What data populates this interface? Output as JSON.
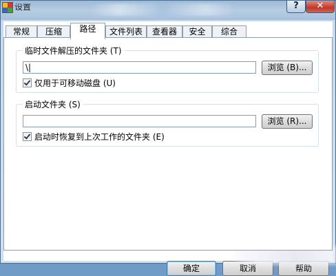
{
  "window": {
    "title": "设置",
    "help_label": "?",
    "close_label": "✕"
  },
  "tabs": [
    {
      "label": "常规"
    },
    {
      "label": "压缩"
    },
    {
      "label": "路径"
    },
    {
      "label": "文件列表"
    },
    {
      "label": "查看器"
    },
    {
      "label": "安全"
    },
    {
      "label": "综合"
    }
  ],
  "active_tab": "路径",
  "temp_group": {
    "title": "临时文件解压的文件夹 (T)",
    "path_value": "\\|",
    "browse_label": "浏览 (B)...",
    "checkbox_label": "仅用于可移动磁盘 (U)",
    "checkbox_checked": true
  },
  "startup_group": {
    "title": "启动文件夹 (S)",
    "path_value": "",
    "browse_label": "浏览 (R)...",
    "checkbox_label": "启动时恢复到上次工作的文件夹 (E)",
    "checkbox_checked": true
  },
  "buttons": {
    "ok": "确定",
    "cancel": "取消",
    "help": "帮助"
  }
}
